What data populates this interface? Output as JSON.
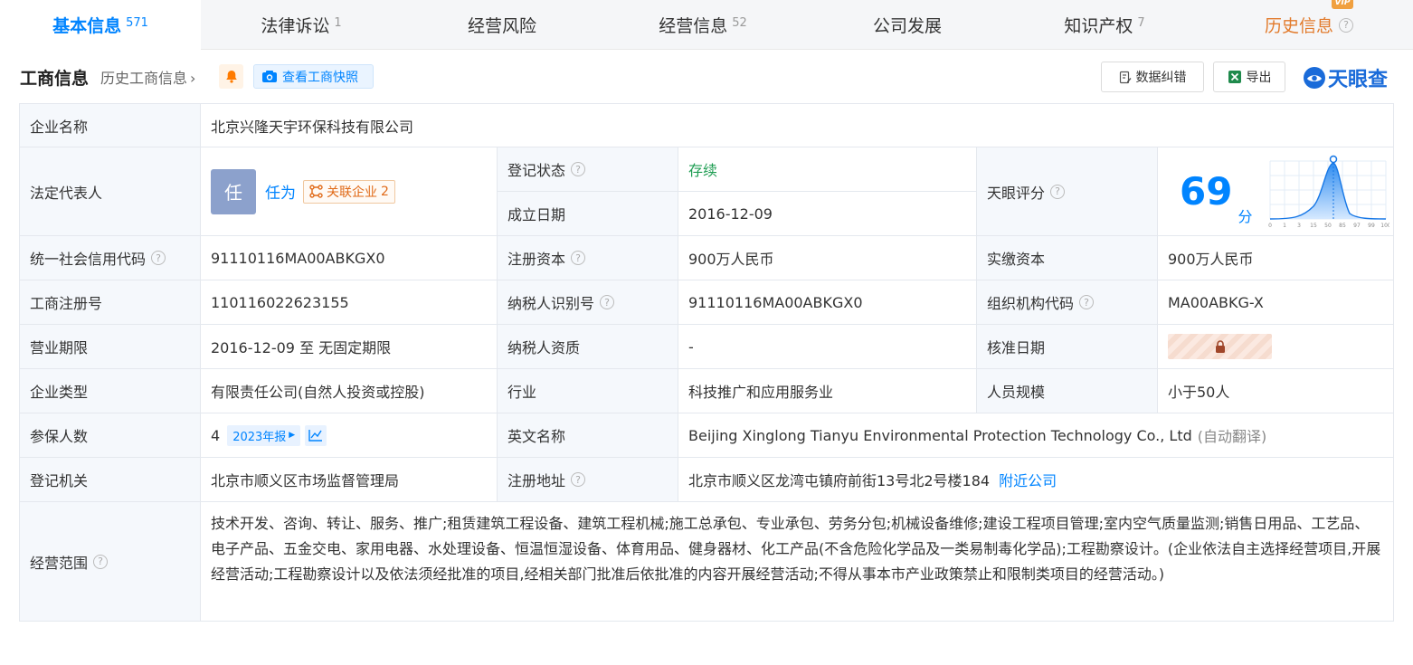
{
  "tabs": [
    {
      "label": "基本信息",
      "count": "571"
    },
    {
      "label": "法律诉讼",
      "count": "1"
    },
    {
      "label": "经营风险",
      "count": ""
    },
    {
      "label": "经营信息",
      "count": "52"
    },
    {
      "label": "公司发展",
      "count": ""
    },
    {
      "label": "知识产权",
      "count": "7"
    },
    {
      "label": "历史信息",
      "count": ""
    }
  ],
  "vip_badge": "VIP",
  "header": {
    "title": "工商信息",
    "history_link": "历史工商信息",
    "snapshot_button": "查看工商快照",
    "correction_button": "数据纠错",
    "export_button": "导出",
    "logo_text": "天眼查"
  },
  "info": {
    "company_name_label": "企业名称",
    "company_name": "北京兴隆天宇环保科技有限公司",
    "legal_rep_label": "法定代表人",
    "legal_rep_avatar": "任",
    "legal_rep_name": "任为",
    "related_label": "关联企业",
    "related_count": "2",
    "reg_status_label": "登记状态",
    "reg_status": "存续",
    "est_date_label": "成立日期",
    "est_date": "2016-12-09",
    "score_label": "天眼评分",
    "score": "69",
    "score_unit": "分",
    "score_axis": [
      "0",
      "1",
      "3",
      "15",
      "50",
      "85",
      "97",
      "99",
      "100"
    ],
    "credit_code_label": "统一社会信用代码",
    "credit_code": "91110116MA00ABKGX0",
    "reg_capital_label": "注册资本",
    "reg_capital": "900万人民币",
    "paid_capital_label": "实缴资本",
    "paid_capital": "900万人民币",
    "reg_no_label": "工商注册号",
    "reg_no": "110116022623155",
    "taxpayer_id_label": "纳税人识别号",
    "taxpayer_id": "91110116MA00ABKGX0",
    "org_code_label": "组织机构代码",
    "org_code": "MA00ABKG-X",
    "term_label": "营业期限",
    "term": "2016-12-09 至 无固定期限",
    "taxpayer_qual_label": "纳税人资质",
    "taxpayer_qual": "-",
    "approve_date_label": "核准日期",
    "company_type_label": "企业类型",
    "company_type": "有限责任公司(自然人投资或控股)",
    "industry_label": "行业",
    "industry": "科技推广和应用服务业",
    "staff_size_label": "人员规模",
    "staff_size": "小于50人",
    "insured_label": "参保人数",
    "insured": "4",
    "insured_year": "2023年报",
    "english_name_label": "英文名称",
    "english_name": "Beijing Xinglong Tianyu Environmental Protection Technology Co., Ltd",
    "auto_translate": "(自动翻译)",
    "authority_label": "登记机关",
    "authority": "北京市顺义区市场监督管理局",
    "address_label": "注册地址",
    "address": "北京市顺义区龙湾屯镇府前街13号北2号楼184",
    "nearby_link": "附近公司",
    "scope_label": "经营范围",
    "scope": "技术开发、咨询、转让、服务、推广;租赁建筑工程设备、建筑工程机械;施工总承包、专业承包、劳务分包;机械设备维修;建设工程项目管理;室内空气质量监测;销售日用品、工艺品、电子产品、五金交电、家用电器、水处理设备、恒温恒湿设备、体育用品、健身器材、化工产品(不含危险化学品及一类易制毒化学品);工程勘察设计。(企业依法自主选择经营项目,开展经营活动;工程勘察设计以及依法须经批准的项目,经相关部门批准后依批准的内容开展经营活动;不得从事本市产业政策禁止和限制类项目的经营活动。)"
  },
  "colors": {
    "accent": "#0084ff",
    "history": "#e27b2c",
    "status_green": "#1e9d52"
  }
}
